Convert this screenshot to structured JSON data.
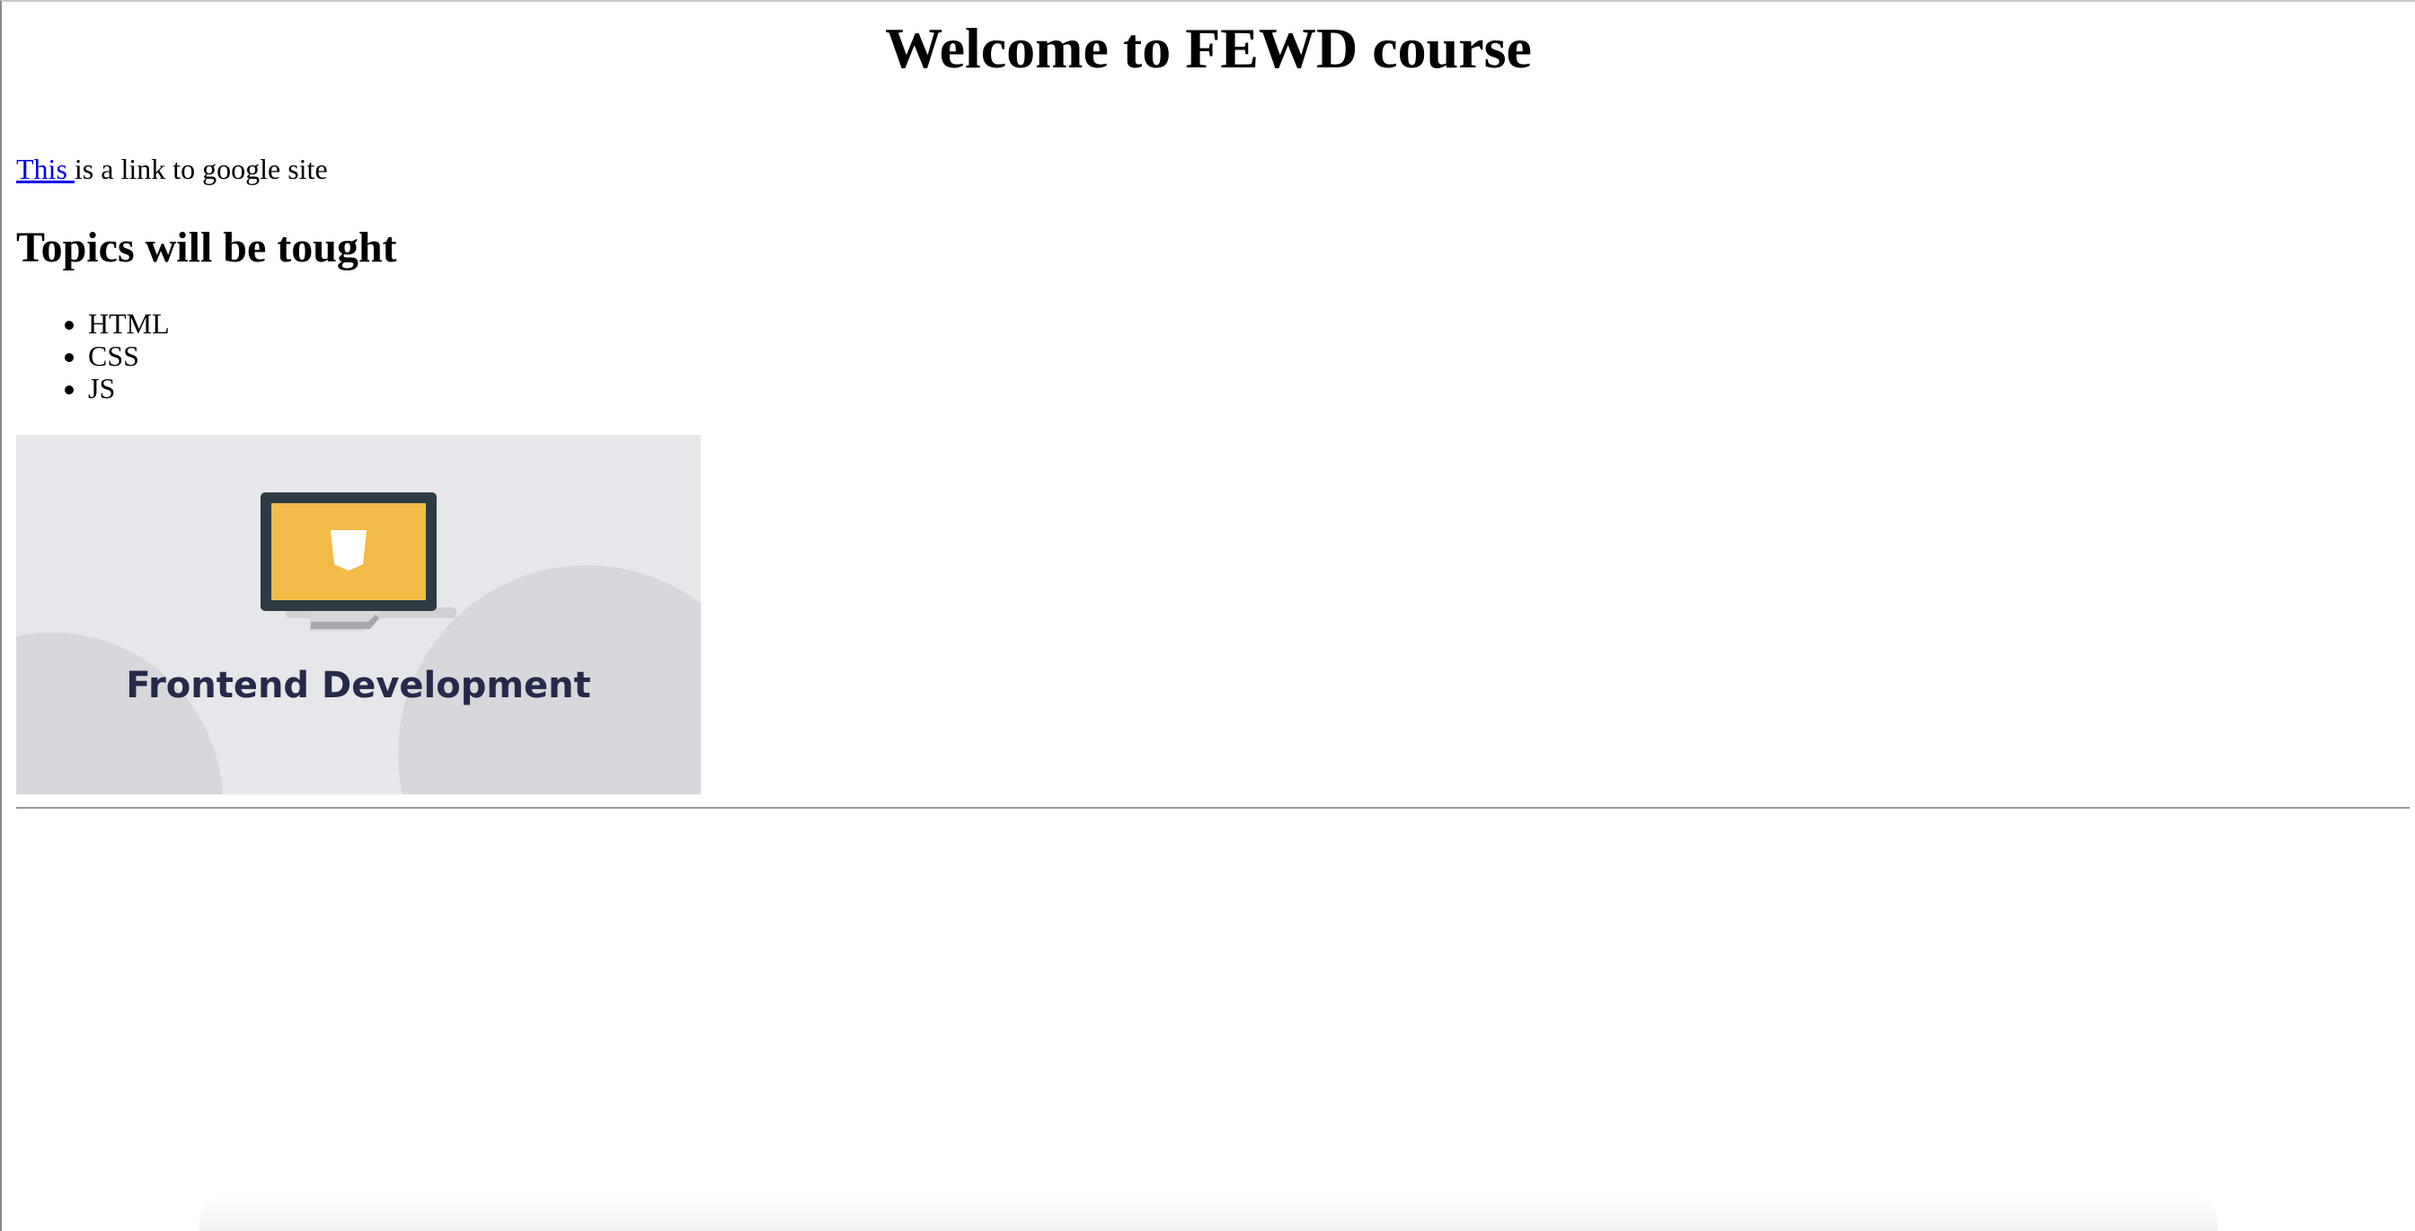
{
  "header": {
    "title": "Welcome to FEWD course"
  },
  "intro": {
    "link_text": "This ",
    "after_link_text": "is a link to google site"
  },
  "topics": {
    "heading": "Topics will be tought",
    "items": [
      "HTML",
      "CSS",
      "JS"
    ]
  },
  "banner": {
    "caption": "Frontend Development",
    "screen_icon": "monitor-icon",
    "badge_icon": "html5-shield-icon",
    "colors": {
      "background": "#e6e7ea",
      "circles": "#d6d8dc",
      "monitor_frame": "#2e3b45",
      "monitor_screen": "#f2bb48",
      "caption": "#252a4a"
    }
  }
}
